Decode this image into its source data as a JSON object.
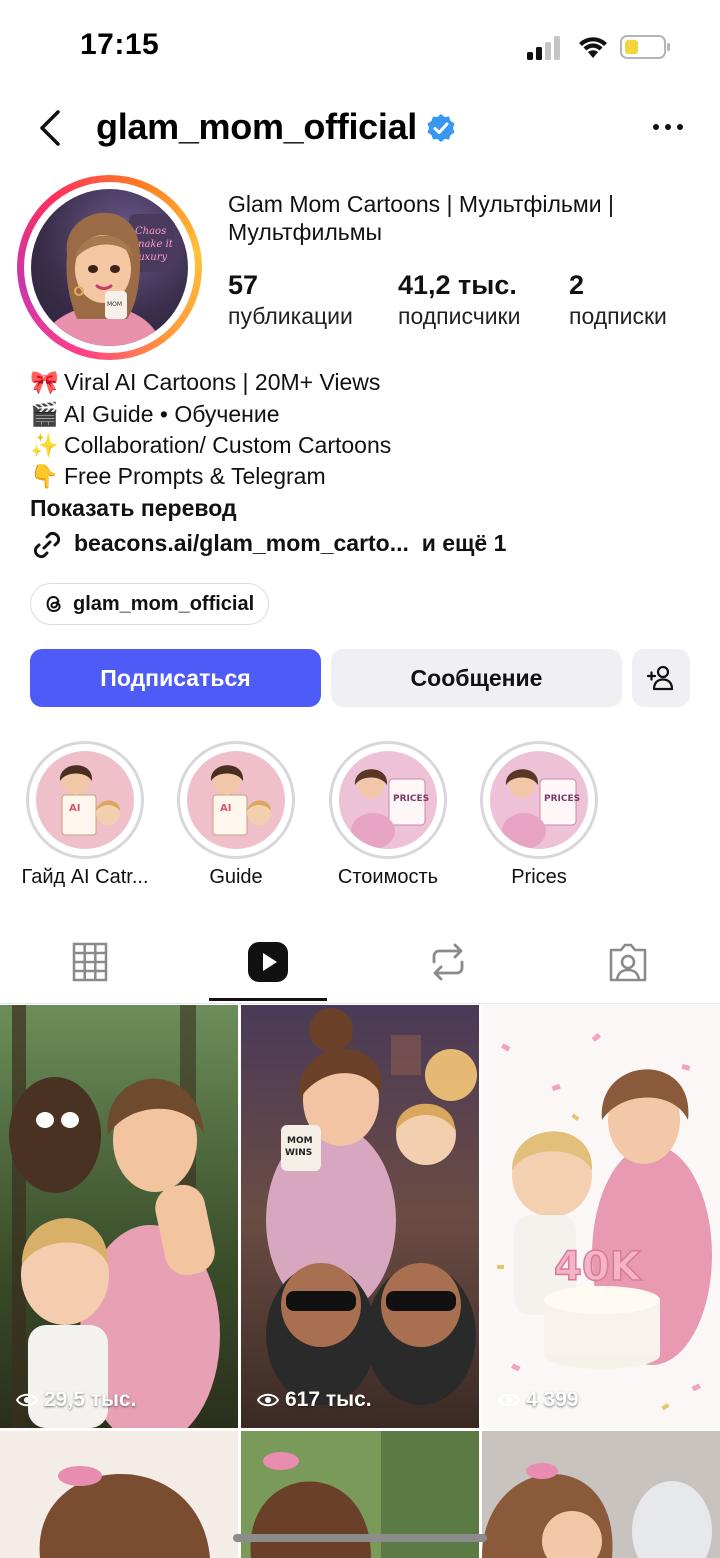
{
  "status_bar": {
    "time": "17:15"
  },
  "header": {
    "username": "glam_mom_official",
    "verified": true
  },
  "profile": {
    "full_name": "Glam Mom Cartoons | Мультфільми | Мультфильмы",
    "stats": [
      {
        "value": "57",
        "label": "публикации"
      },
      {
        "value": "41,2 тыс.",
        "label": "подписчики"
      },
      {
        "value": "2",
        "label": "подписки"
      }
    ],
    "bio": [
      {
        "emoji": "🎀",
        "text": "Viral AI Cartoons | 20M+ Views"
      },
      {
        "emoji": "🎬",
        "text": "AI Guide • Обучение"
      },
      {
        "emoji": "✨",
        "text": "Collaboration/ Custom Cartoons"
      },
      {
        "emoji": "👇",
        "text": "Free Prompts & Telegram"
      }
    ],
    "show_translation": "Показать перевод",
    "link": "beacons.ai/glam_mom_carto...",
    "link_more": "и ещё 1",
    "threads_handle": "glam_mom_official"
  },
  "actions": {
    "follow": "Подписаться",
    "message": "Сообщение"
  },
  "highlights": [
    {
      "label": "Гайд AI Catr..."
    },
    {
      "label": "Guide"
    },
    {
      "label": "Стоимость"
    },
    {
      "label": "Prices"
    }
  ],
  "tabs": [
    {
      "name": "grid",
      "icon": "grid-icon"
    },
    {
      "name": "reels",
      "icon": "reels-icon",
      "active": true
    },
    {
      "name": "reposts",
      "icon": "repost-icon"
    },
    {
      "name": "tagged",
      "icon": "tagged-icon"
    }
  ],
  "posts": [
    {
      "views": "29,5 тыс."
    },
    {
      "views": "617 тыс."
    },
    {
      "views": "4 399"
    }
  ],
  "colors": {
    "follow_button": "#4f5bf6",
    "verified": "#3897f0"
  }
}
